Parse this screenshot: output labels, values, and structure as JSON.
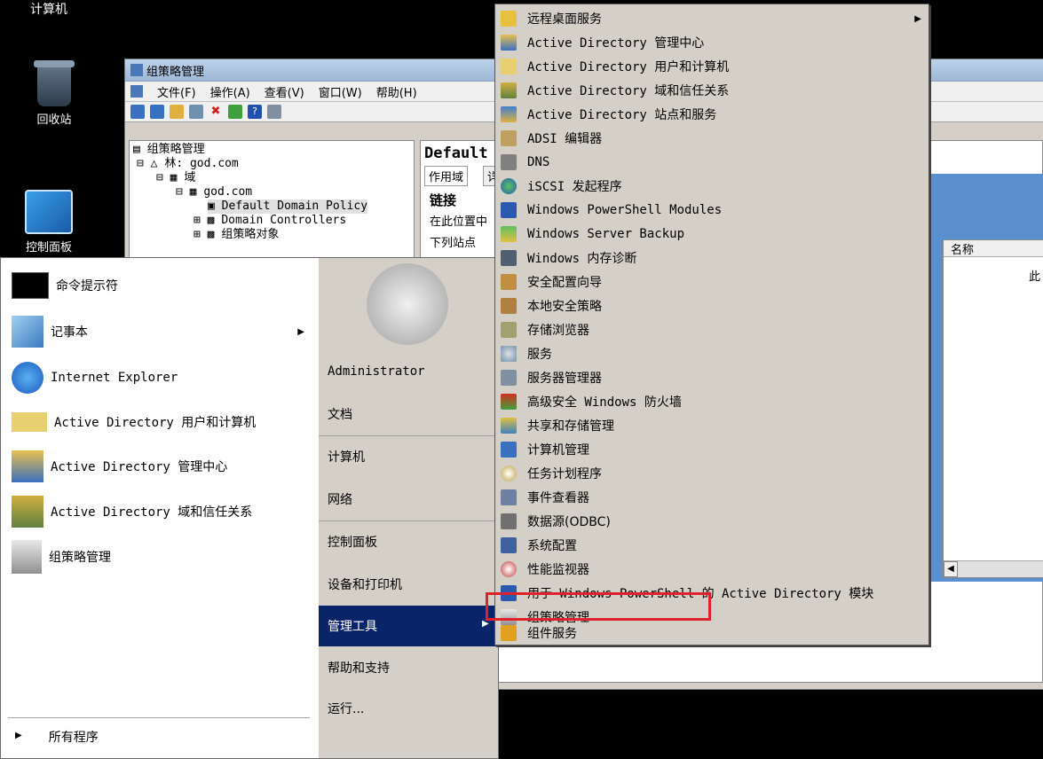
{
  "desktop": {
    "computer_label": "计算机",
    "recycle_label": "回收站",
    "control_panel_label": "控制面板"
  },
  "gpm_window": {
    "title": "组策略管理",
    "menus": [
      "文件(F)",
      "操作(A)",
      "查看(V)",
      "窗口(W)",
      "帮助(H)"
    ],
    "tree": {
      "root": "组策略管理",
      "forest": "林: god.com",
      "domains": "域",
      "domain": "god.com",
      "policy": "Default Domain Policy",
      "dc": "Domain Controllers",
      "gpo": "组策略对象"
    },
    "detail": {
      "heading": "Default",
      "tab_scope": "作用域",
      "tab_other": "详",
      "link_heading": "链接",
      "link_text": "在此位置中",
      "site_text": "下列站点"
    },
    "list": {
      "col_name": "名称",
      "empty_text": "此"
    }
  },
  "start_menu": {
    "programs": [
      {
        "label": "命令提示符",
        "icon": "cmd-icon"
      },
      {
        "label": "记事本",
        "icon": "notepad-icon",
        "submenu": true
      },
      {
        "label": "Internet Explorer",
        "icon": "ie-icon"
      },
      {
        "label": "Active Directory 用户和计算机",
        "icon": "ad-users-icon"
      },
      {
        "label": "Active Directory 管理中心",
        "icon": "ad-admin-center-icon"
      },
      {
        "label": "Active Directory 域和信任关系",
        "icon": "ad-domains-icon"
      },
      {
        "label": "组策略管理",
        "icon": "gpm-icon"
      }
    ],
    "all_programs": "所有程序",
    "right_links": [
      "Administrator",
      "文档",
      "计算机",
      "网络",
      "控制面板",
      "设备和打印机",
      "管理工具",
      "帮助和支持",
      "运行..."
    ],
    "selected_link": "管理工具"
  },
  "admin_tools": {
    "items": [
      {
        "label": "远程桌面服务",
        "icon": "folder-icon",
        "submenu": true
      },
      {
        "label": "Active Directory 管理中心",
        "icon": "ad-admin-center-icon"
      },
      {
        "label": "Active Directory 用户和计算机",
        "icon": "ad-users-icon"
      },
      {
        "label": "Active Directory 域和信任关系",
        "icon": "ad-domains-icon"
      },
      {
        "label": "Active Directory 站点和服务",
        "icon": "ad-sites-icon"
      },
      {
        "label": "ADSI 编辑器",
        "icon": "adsi-icon"
      },
      {
        "label": "DNS",
        "icon": "dns-icon"
      },
      {
        "label": "iSCSI 发起程序",
        "icon": "iscsi-icon"
      },
      {
        "label": "Windows PowerShell Modules",
        "icon": "powershell-icon"
      },
      {
        "label": "Windows Server Backup",
        "icon": "backup-icon"
      },
      {
        "label": "Windows 内存诊断",
        "icon": "memory-icon"
      },
      {
        "label": "安全配置向导",
        "icon": "security-wizard-icon"
      },
      {
        "label": "本地安全策略",
        "icon": "local-policy-icon"
      },
      {
        "label": "存储浏览器",
        "icon": "storage-icon"
      },
      {
        "label": "服务",
        "icon": "services-icon"
      },
      {
        "label": "服务器管理器",
        "icon": "server-manager-icon"
      },
      {
        "label": "高级安全 Windows 防火墙",
        "icon": "firewall-icon"
      },
      {
        "label": "共享和存储管理",
        "icon": "share-icon"
      },
      {
        "label": "计算机管理",
        "icon": "computer-mgmt-icon"
      },
      {
        "label": "任务计划程序",
        "icon": "scheduler-icon"
      },
      {
        "label": "事件查看器",
        "icon": "event-viewer-icon"
      },
      {
        "label": "数据源(ODBC)",
        "icon": "odbc-icon"
      },
      {
        "label": "系统配置",
        "icon": "msconfig-icon"
      },
      {
        "label": "性能监视器",
        "icon": "perfmon-icon"
      },
      {
        "label": "用于 Windows PowerShell 的 Active Directory 模块",
        "icon": "ad-powershell-icon"
      },
      {
        "label": "组策略管理",
        "icon": "gpm-icon"
      },
      {
        "label": "组件服务",
        "icon": "component-services-icon"
      }
    ],
    "highlighted": "组策略管理"
  },
  "colors": {
    "selection": "#0a246a",
    "highlight_border": "#e0202a",
    "menu_bg": "#d4d0c8"
  }
}
